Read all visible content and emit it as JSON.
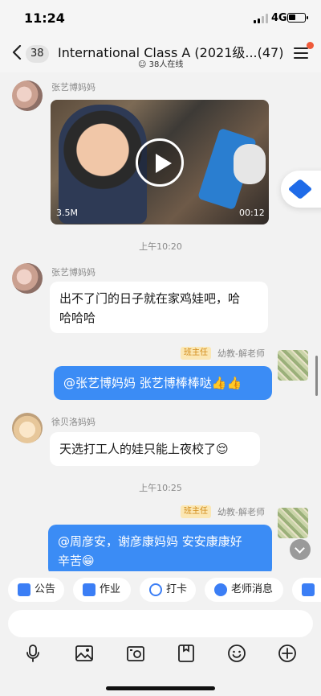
{
  "status_bar": {
    "time": "11:24",
    "network": "4G",
    "battery_level": 0.4
  },
  "header": {
    "back_count": "38",
    "title": "International Class A (2021级...(47)",
    "online": "38人在线"
  },
  "messages": [
    {
      "sender": "张艺博妈妈",
      "type": "video",
      "size": "3.5M",
      "duration": "00:12"
    },
    {
      "time": "上午10:20"
    },
    {
      "sender": "张艺博妈妈",
      "text_line1": "出不了门的日子就在家鸡娃吧，哈",
      "text_line2": "哈哈哈"
    },
    {
      "sender": "幼教-解老师",
      "role": "班主任",
      "text": "@张艺博妈妈 张艺博棒棒哒👍👍"
    },
    {
      "sender": "徐贝洛妈妈",
      "text": "天选打工人的娃只能上夜校了😌"
    },
    {
      "time": "上午10:25"
    },
    {
      "sender": "幼教-解老师",
      "role": "班主任",
      "text_line1": "@周彦安，谢彦康妈妈 安安康康好",
      "text_line2": "辛苦😁"
    }
  ],
  "quick_actions": [
    {
      "label": "公告",
      "icon": "announcement-icon",
      "color": "#3b7ef5"
    },
    {
      "label": "作业",
      "icon": "homework-icon",
      "color": "#3b7ef5"
    },
    {
      "label": "打卡",
      "icon": "checkin-icon",
      "color": "#3b7ef5"
    },
    {
      "label": "老师消息",
      "icon": "teacher-message-icon",
      "color": "#3b7ef5"
    },
    {
      "label": "",
      "icon": "book-icon",
      "color": "#3b7ef5"
    }
  ],
  "toolbar": {
    "icons": [
      "microphone-icon",
      "image-icon",
      "camera-icon",
      "file-icon",
      "emoji-icon",
      "plus-icon"
    ]
  },
  "colors": {
    "accent": "#3b8cf5",
    "badge_bg": "#fbe7b4",
    "badge_text": "#d18a17",
    "notify_dot": "#ef5a3a"
  }
}
